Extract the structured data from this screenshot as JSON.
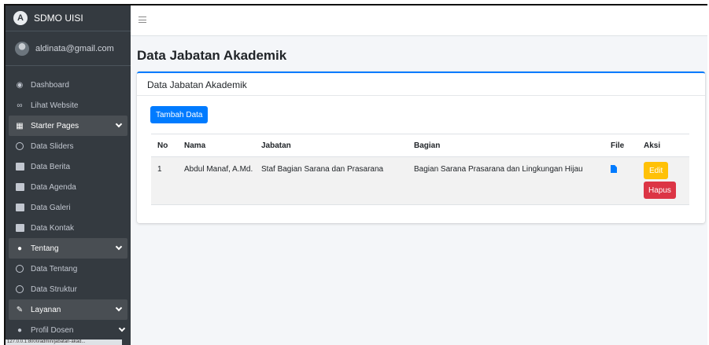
{
  "brand": {
    "name": "SDMO UISI",
    "logo_letter": "A"
  },
  "user": {
    "email": "aldinata@gmail.com"
  },
  "sidebar": {
    "items": [
      {
        "label": "Dashboard",
        "icon": "tachometer-icon"
      },
      {
        "label": "Lihat Website",
        "icon": "link-icon"
      },
      {
        "label": "Starter Pages",
        "icon": "table-icon",
        "expanded": true
      },
      {
        "label": "Data Sliders",
        "icon": "circle-icon"
      },
      {
        "label": "Data Berita",
        "icon": "image-icon"
      },
      {
        "label": "Data Agenda",
        "icon": "calendar-icon"
      },
      {
        "label": "Data Galeri",
        "icon": "photo-icon"
      },
      {
        "label": "Data Kontak",
        "icon": "contact-icon"
      },
      {
        "label": "Tentang",
        "icon": "user-icon",
        "expanded": true
      },
      {
        "label": "Data Tentang",
        "icon": "circle-icon"
      },
      {
        "label": "Data Struktur",
        "icon": "circle-icon"
      },
      {
        "label": "Layanan",
        "icon": "edit-icon",
        "expanded": true
      },
      {
        "label": "Profil Dosen",
        "icon": "user-icon"
      }
    ]
  },
  "status_url": "127.0.0.1:8000/admin/jabatan-akad...",
  "main": {
    "page_title": "Data Jabatan Akademik",
    "card_title": "Data Jabatan Akademik",
    "add_button": "Tambah Data",
    "table": {
      "columns": [
        "No",
        "Nama",
        "Jabatan",
        "Bagian",
        "File",
        "Aksi"
      ],
      "rows": [
        {
          "no": "1",
          "nama": "Abdul Manaf, A.Md.",
          "jabatan": "Staf Bagian Sarana dan Prasarana",
          "bagian": "Bagian Sarana Prasarana dan Lingkungan Hijau",
          "file_icon": "file-icon",
          "edit_label": "Edit",
          "delete_label": "Hapus"
        }
      ]
    }
  },
  "colors": {
    "sidebar_bg": "#343a40",
    "primary": "#007bff",
    "warning": "#ffc107",
    "danger": "#dc3545"
  }
}
